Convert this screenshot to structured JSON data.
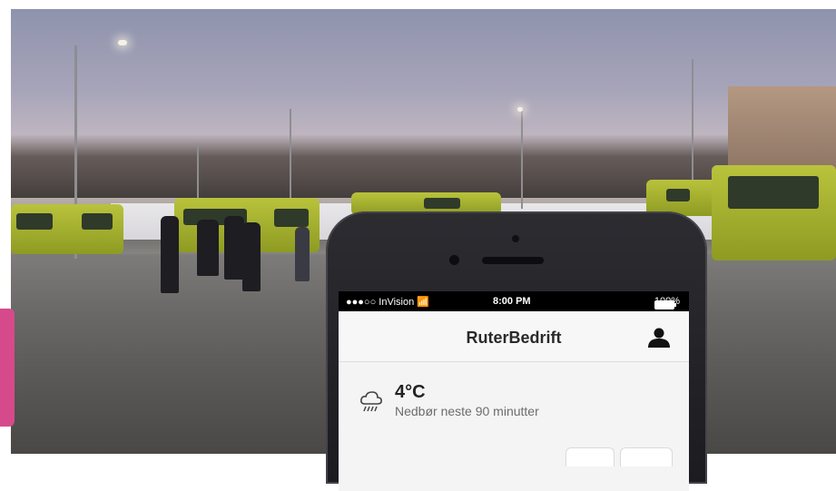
{
  "scene": {
    "description_icon": "photo-background"
  },
  "phone": {
    "status": {
      "carrier": "●●●○○ InVision",
      "wifi_icon": "wifi-icon",
      "time": "8:00 PM",
      "battery": "100%"
    },
    "app_title": "RuterBedrift",
    "weather": {
      "temperature": "4°C",
      "description": "Nedbør neste 90 minutter"
    }
  }
}
